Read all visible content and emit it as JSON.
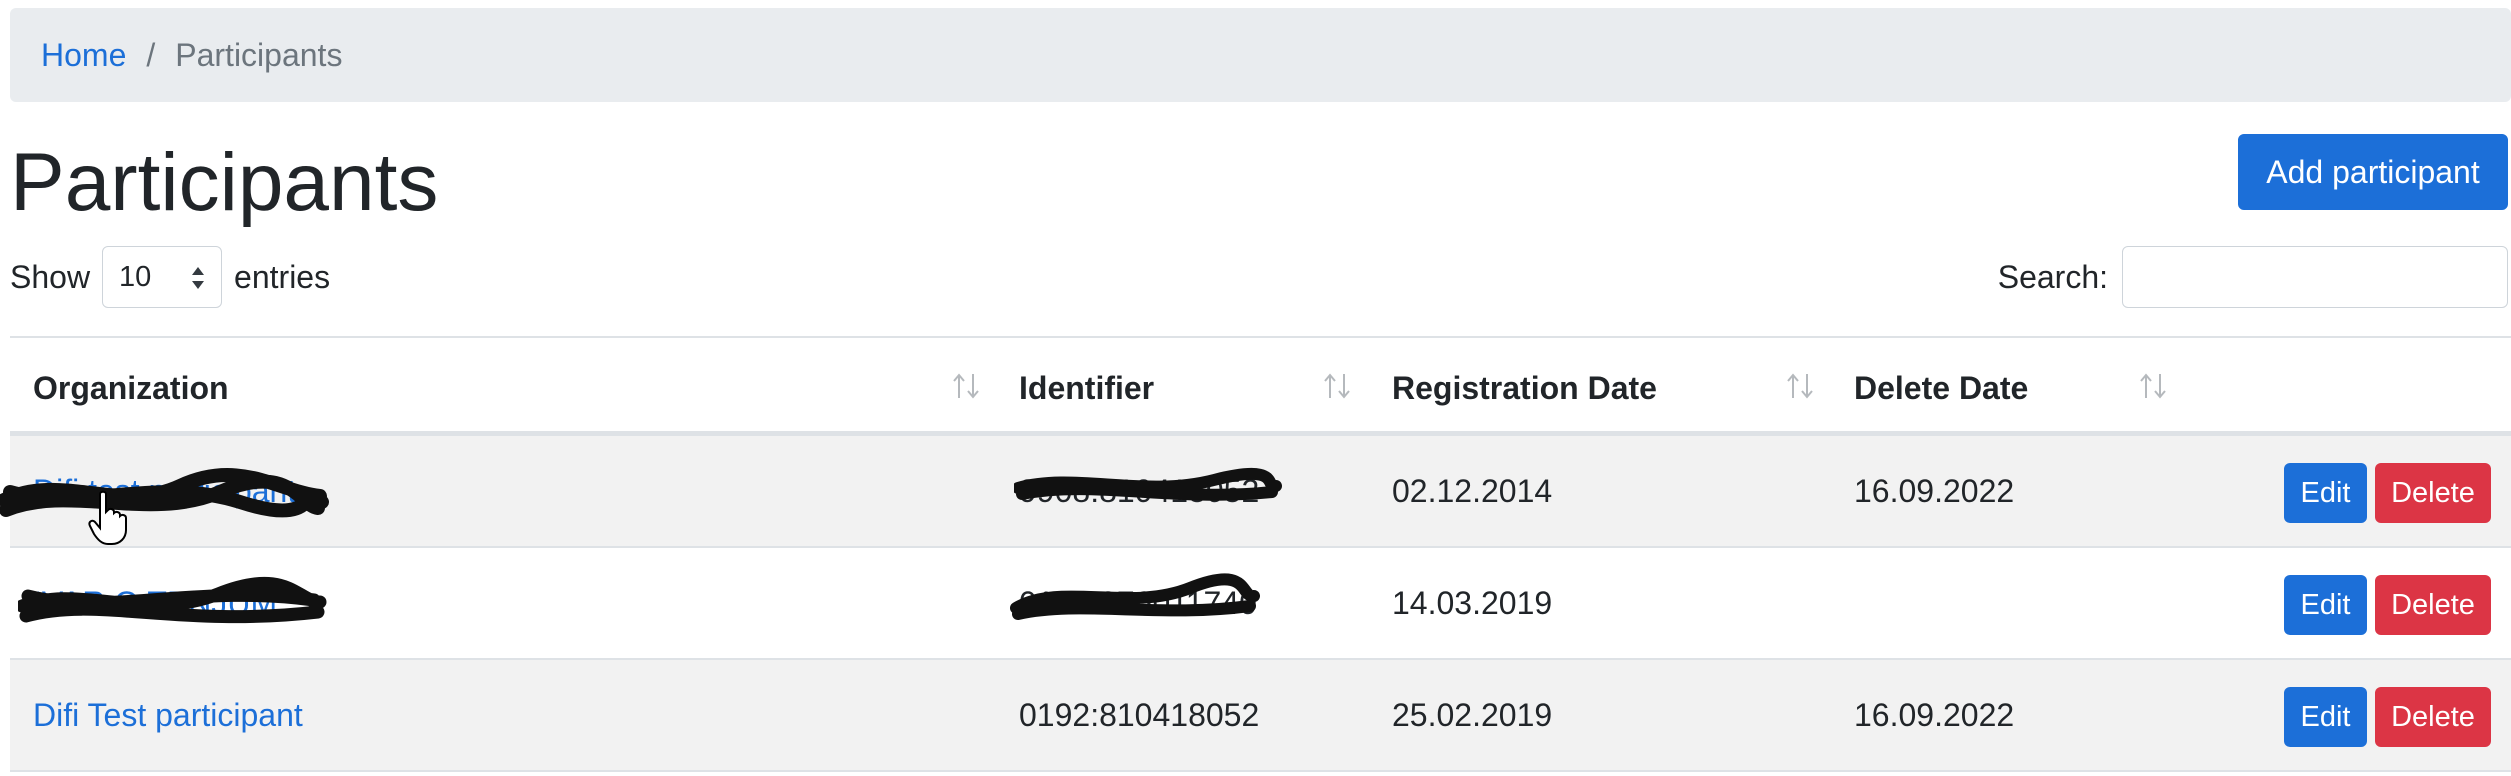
{
  "breadcrumb": {
    "home": "Home",
    "separator": "/",
    "current": "Participants"
  },
  "page_title": "Participants",
  "add_button": "Add participant",
  "length_control": {
    "show": "Show",
    "value": "10",
    "entries": "entries"
  },
  "search": {
    "label": "Search:",
    "value": "",
    "placeholder": ""
  },
  "table": {
    "headers": [
      "Organization",
      "Identifier",
      "Registration Date",
      "Delete Date"
    ],
    "rows": [
      {
        "organization": "Difi test participant",
        "identifier": "9908:810418052",
        "registration_date": "02.12.2014",
        "delete_date": "16.09.2022",
        "edit": "Edit",
        "delete": "Delete"
      },
      {
        "organization": "IVAR O TENJUM",
        "identifier": "0192:976011740",
        "registration_date": "14.03.2019",
        "delete_date": "",
        "edit": "Edit",
        "delete": "Delete"
      },
      {
        "organization": "Difi Test participant",
        "identifier": "0192:810418052",
        "registration_date": "25.02.2019",
        "delete_date": "16.09.2022",
        "edit": "Edit",
        "delete": "Delete"
      }
    ]
  },
  "colors": {
    "primary": "#1c6fd8",
    "danger": "#dc3545",
    "breadcrumb_bg": "#e9ecef",
    "stripe": "#f2f2f2"
  },
  "icons": {
    "sort": "sort-both-icon",
    "select_arrows": "select-arrows-icon",
    "cursor": "hand-pointer-icon"
  }
}
